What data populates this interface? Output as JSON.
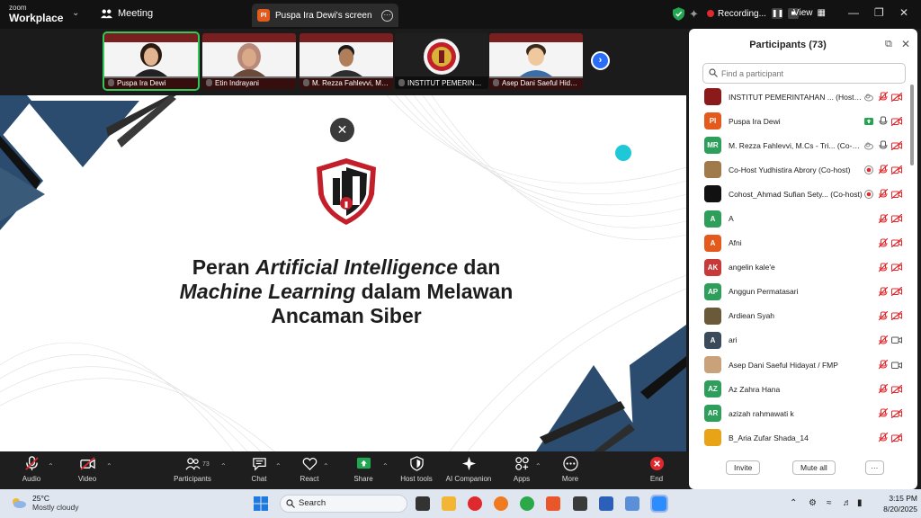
{
  "titlebar": {
    "brand_line1": "zoom",
    "brand_line2": "Workplace",
    "meeting_label": "Meeting",
    "screen_tab_label": "Puspa Ira Dewi's screen",
    "screen_tab_badge": "PI",
    "recording_label": "Recording...",
    "view_label": "View"
  },
  "thumbnails": [
    {
      "name": "Puspa Ira Dewi",
      "active": true
    },
    {
      "name": "Etin Indrayani",
      "active": false
    },
    {
      "name": "M. Rezza Fahlevvi, M.Cs...",
      "active": false
    },
    {
      "name": "INSTITUT PEMERINTA...",
      "active": false
    },
    {
      "name": "Asep Dani Saeful Hida...",
      "active": false
    }
  ],
  "slide": {
    "title_line1_a": "Peran ",
    "title_line1_b": "Artificial Intelligence",
    "title_line1_c": " dan",
    "title_line2_a": "Machine Learning",
    "title_line2_b": " dalam Melawan",
    "title_line3": "Ancaman Siber"
  },
  "toolbar": {
    "audio": "Audio",
    "video": "Video",
    "participants": "Participants",
    "participants_count": "73",
    "chat": "Chat",
    "react": "React",
    "share": "Share",
    "host_tools": "Host tools",
    "ai_companion": "AI Companion",
    "apps": "Apps",
    "more": "More",
    "end": "End"
  },
  "panel": {
    "title": "Participants (73)",
    "search_placeholder": "Find a participant",
    "invite": "Invite",
    "mute_all": "Mute all",
    "more": "···",
    "participants": [
      {
        "initials": "",
        "name": "INSTITUT PEMERINTAHAN ... (Host, me)",
        "color": "#8b1a1a",
        "mic": "muted",
        "video": "off",
        "extra": "cloud"
      },
      {
        "initials": "PI",
        "name": "Puspa Ira Dewi",
        "color": "#e35a1c",
        "mic": "on",
        "video": "off",
        "extra": "share"
      },
      {
        "initials": "MR",
        "name": "M. Rezza Fahlevvi, M.Cs - Tri... (Co-host)",
        "color": "#2e9e5b",
        "mic": "on",
        "video": "off",
        "extra": "cloud"
      },
      {
        "initials": "",
        "name": "Co-Host Yudhistira Abrory (Co-host)",
        "color": "#a07a4a",
        "mic": "muted",
        "video": "off",
        "extra": "rec"
      },
      {
        "initials": "",
        "name": "Cohost_Ahmad Sufian Sety... (Co-host)",
        "color": "#111111",
        "mic": "muted",
        "video": "off",
        "extra": "rec"
      },
      {
        "initials": "A",
        "name": "A",
        "color": "#2e9e5b",
        "mic": "muted",
        "video": "off",
        "extra": ""
      },
      {
        "initials": "A",
        "name": "Afni",
        "color": "#e35a1c",
        "mic": "muted",
        "video": "off",
        "extra": ""
      },
      {
        "initials": "AK",
        "name": "angelin kale'e",
        "color": "#c73a3a",
        "mic": "muted",
        "video": "off",
        "extra": ""
      },
      {
        "initials": "AP",
        "name": "Anggun Permatasari",
        "color": "#2e9e5b",
        "mic": "muted",
        "video": "off",
        "extra": ""
      },
      {
        "initials": "",
        "name": "Ardiean Syah",
        "color": "#6b5a3a",
        "mic": "muted",
        "video": "off",
        "extra": ""
      },
      {
        "initials": "A",
        "name": "ari",
        "color": "#3a4a5a",
        "mic": "muted",
        "video": "on",
        "extra": ""
      },
      {
        "initials": "",
        "name": "Asep Dani Saeful Hidayat / FMP",
        "color": "#c9a27a",
        "mic": "muted",
        "video": "on",
        "extra": ""
      },
      {
        "initials": "AZ",
        "name": "Az Zahra Hana",
        "color": "#2e9e5b",
        "mic": "muted",
        "video": "off",
        "extra": ""
      },
      {
        "initials": "AR",
        "name": "azizah rahmawati k",
        "color": "#2e9e5b",
        "mic": "muted",
        "video": "off",
        "extra": ""
      },
      {
        "initials": "",
        "name": "B_Aria Zufar Shada_14",
        "color": "#e8a317",
        "mic": "muted",
        "video": "off",
        "extra": ""
      }
    ]
  },
  "taskbar": {
    "temp": "25°C",
    "weather": "Mostly cloudy",
    "search": "Search",
    "time": "3:15 PM",
    "date": "8/20/2025"
  },
  "colors": {
    "accent_blue": "#2a6ef7",
    "muted_red": "#e0292e",
    "share_green": "#22a651",
    "slide_navy": "#2b4c6f"
  }
}
